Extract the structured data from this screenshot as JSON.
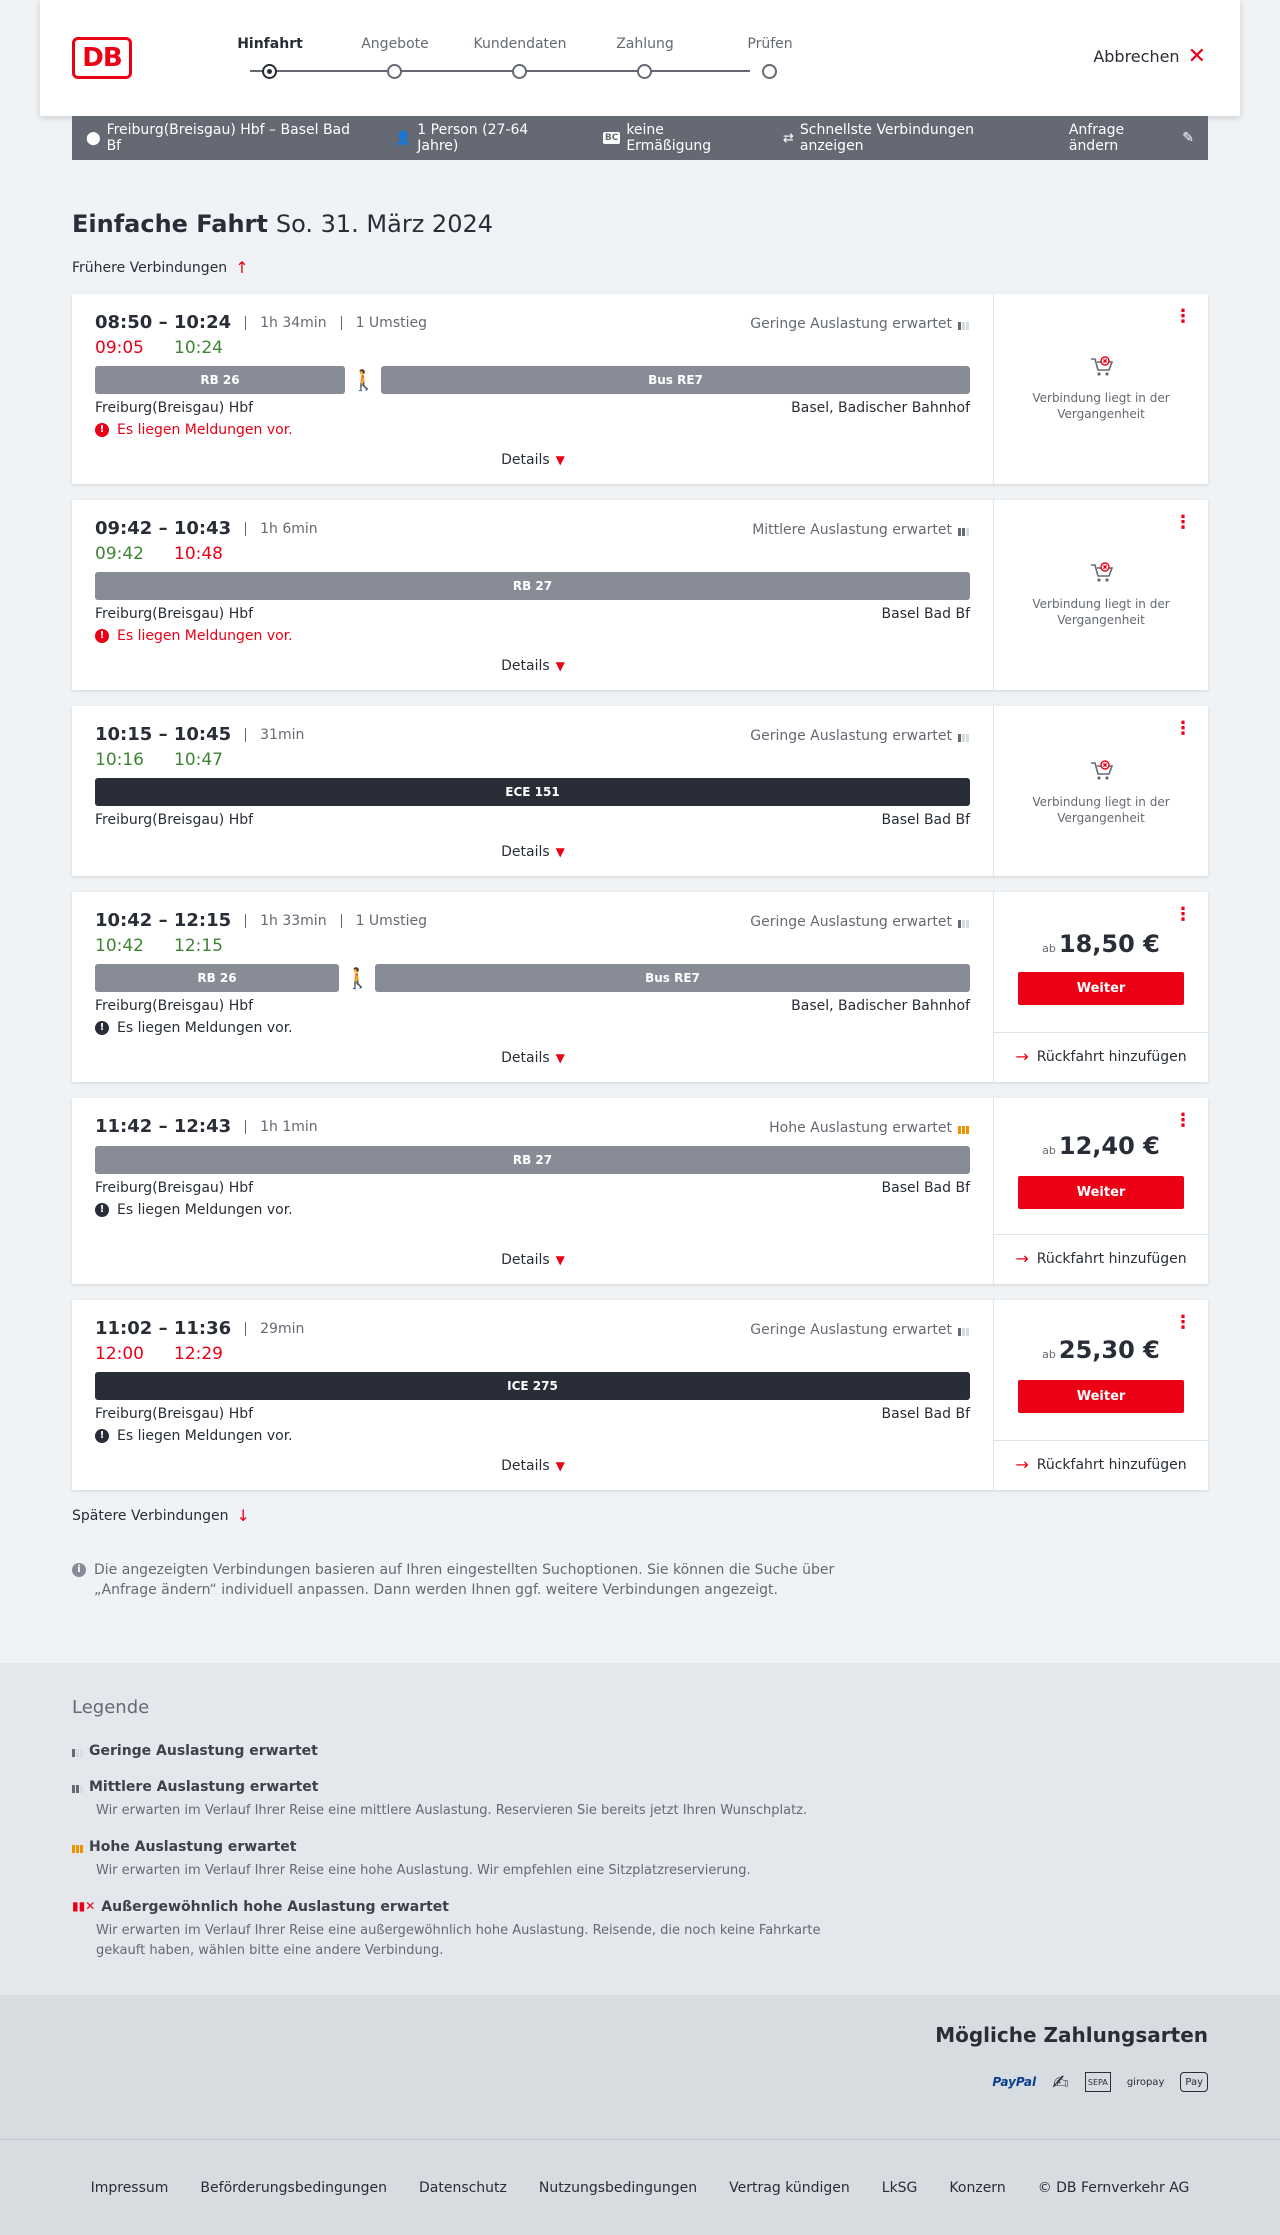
{
  "header": {
    "logo_text": "DB",
    "steps": [
      "Hinfahrt",
      "Angebote",
      "Kundendaten",
      "Zahlung",
      "Prüfen"
    ],
    "active_step": "Hinfahrt",
    "cancel_label": "Abbrechen"
  },
  "query": {
    "route": "Freiburg(Breisgau) Hbf – Basel Bad Bf",
    "persons": "1 Person (27-64 Jahre)",
    "discount_badge": "BC",
    "discount": "keine Ermäßigung",
    "fastest": "Schnellste Verbindungen anzeigen",
    "change": "Anfrage ändern"
  },
  "page": {
    "title": "Einfache Fahrt",
    "date": "So. 31. März 2024",
    "earlier": "Frühere Verbindungen",
    "later": "Spätere Verbindungen",
    "details_label": "Details",
    "past_text": "Verbindung liegt in der Vergangenheit",
    "price_prefix": "ab",
    "continue_label": "Weiter",
    "return_label": "Rückfahrt hinzufügen"
  },
  "connections": [
    {
      "time": "08:50 – 10:24",
      "duration": "1h 34min",
      "transfers": "1 Umstieg",
      "rt_dep": "09:05",
      "rt_arr": "10:24",
      "rt_dep_color": "red",
      "rt_arr_color": "green",
      "load": "Geringe Auslastung erwartet",
      "load_level": 1,
      "segments": [
        "RB 26",
        "Bus RE7"
      ],
      "from": "Freiburg(Breisgau) Hbf",
      "to": "Basel, Badischer Bahnhof",
      "message": "Es liegen Meldungen vor.",
      "message_style": "red",
      "past": true
    },
    {
      "time": "09:42 – 10:43",
      "duration": "1h 6min",
      "transfers": "",
      "rt_dep": "09:42",
      "rt_arr": "10:48",
      "rt_dep_color": "green",
      "rt_arr_color": "red",
      "load": "Mittlere Auslastung erwartet",
      "load_level": 2,
      "segments": [
        "RB 27"
      ],
      "from": "Freiburg(Breisgau) Hbf",
      "to": "Basel Bad Bf",
      "message": "Es liegen Meldungen vor.",
      "message_style": "red",
      "past": true
    },
    {
      "time": "10:15 – 10:45",
      "duration": "31min",
      "transfers": "",
      "rt_dep": "10:16",
      "rt_arr": "10:47",
      "rt_dep_color": "green",
      "rt_arr_color": "green",
      "load": "Geringe Auslastung erwartet",
      "load_level": 1,
      "segments": [
        "ECE 151"
      ],
      "from": "Freiburg(Breisgau) Hbf",
      "to": "Basel Bad Bf",
      "message": "",
      "message_style": "",
      "past": true
    },
    {
      "time": "10:42 – 12:15",
      "duration": "1h 33min",
      "transfers": "1 Umstieg",
      "rt_dep": "10:42",
      "rt_arr": "12:15",
      "rt_dep_color": "green",
      "rt_arr_color": "green",
      "load": "Geringe Auslastung erwartet",
      "load_level": 1,
      "segments": [
        "RB 26",
        "Bus RE7"
      ],
      "from": "Freiburg(Breisgau) Hbf",
      "to": "Basel, Badischer Bahnhof",
      "message": "Es liegen Meldungen vor.",
      "message_style": "black",
      "past": false,
      "price": "18,50 €"
    },
    {
      "time": "11:42 – 12:43",
      "duration": "1h 1min",
      "transfers": "",
      "rt_dep": "",
      "rt_arr": "",
      "load": "Hohe Auslastung erwartet",
      "load_level": 3,
      "segments": [
        "RB 27"
      ],
      "from": "Freiburg(Breisgau) Hbf",
      "to": "Basel Bad Bf",
      "message": "Es liegen Meldungen vor.",
      "message_style": "black",
      "past": false,
      "price": "12,40 €"
    },
    {
      "time": "11:02 – 11:36",
      "duration": "29min",
      "transfers": "",
      "rt_dep": "12:00",
      "rt_arr": "12:29",
      "rt_dep_color": "red",
      "rt_arr_color": "red",
      "load": "Geringe Auslastung erwartet",
      "load_level": 1,
      "segments": [
        "ICE 275"
      ],
      "from": "Freiburg(Breisgau) Hbf",
      "to": "Basel Bad Bf",
      "message": "Es liegen Meldungen vor.",
      "message_style": "black",
      "past": false,
      "price": "25,30 €"
    }
  ],
  "info_text": "Die angezeigten Verbindungen basieren auf Ihren eingestellten Suchoptionen. Sie können die Suche über „Anfrage ändern“ individuell anpassen. Dann werden Ihnen ggf. weitere Verbindungen angezeigt.",
  "legend": {
    "title": "Legende",
    "items": [
      {
        "title": "Geringe Auslastung erwartet",
        "desc": ""
      },
      {
        "title": "Mittlere Auslastung erwartet",
        "desc": "Wir erwarten im Verlauf Ihrer Reise eine mittlere Auslastung. Reservieren Sie bereits jetzt Ihren Wunschplatz."
      },
      {
        "title": "Hohe Auslastung erwartet",
        "desc": "Wir erwarten im Verlauf Ihrer Reise eine hohe Auslastung. Wir empfehlen eine Sitzplatzreservierung."
      },
      {
        "title": "Außergewöhnlich hohe Auslastung erwartet",
        "desc": "Wir erwarten im Verlauf Ihrer Reise eine außergewöhnlich hohe Auslastung. Reisende, die noch keine Fahrkarte gekauft haben, wählen bitte eine andere Verbindung."
      }
    ]
  },
  "payment": {
    "title": "Mögliche Zahlungsarten",
    "methods": [
      "PayPal",
      "SEPA",
      "giropay",
      "Pay"
    ]
  },
  "footer": {
    "links": [
      "Impressum",
      "Beförderungsbedingungen",
      "Datenschutz",
      "Nutzungsbedingungen",
      "Vertrag kündigen",
      "LkSG",
      "Konzern",
      "© DB Fernverkehr AG"
    ]
  },
  "colors": {
    "brand_red": "#ec0016",
    "delay_red": "#ec0016",
    "ontime_green": "#408335",
    "high_load": "#f39200"
  }
}
